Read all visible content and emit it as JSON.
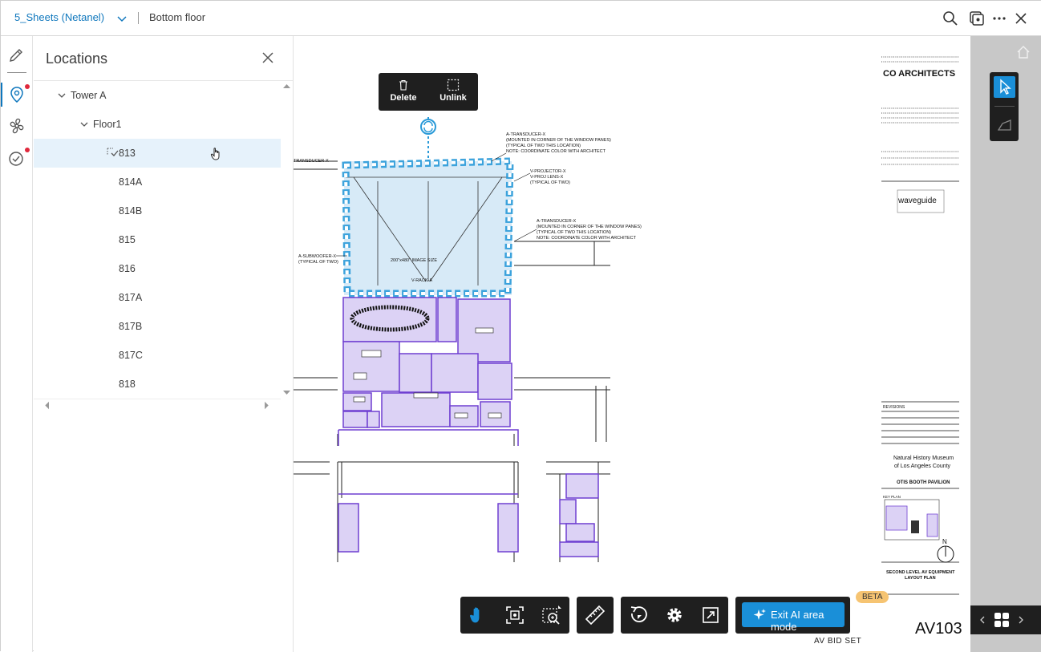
{
  "topbar": {
    "project_name": "5_Sheets",
    "project_owner": "(Netanel)",
    "sheet_name": "Bottom floor",
    "icons": [
      "search-icon",
      "compare-icon",
      "more-icon",
      "close-icon"
    ]
  },
  "rail": {
    "items": [
      "markup-pen-icon",
      "location-pin-icon",
      "fan-icon",
      "checklist-icon"
    ]
  },
  "locations_panel": {
    "title": "Locations",
    "tree": [
      {
        "label": "Tower A",
        "level": 0,
        "expanded": true
      },
      {
        "label": "Floor1",
        "level": 1,
        "expanded": true
      },
      {
        "label": "813",
        "level": 2,
        "selected": true
      },
      {
        "label": "814A",
        "level": 2
      },
      {
        "label": "814B",
        "level": 2
      },
      {
        "label": "815",
        "level": 2
      },
      {
        "label": "816",
        "level": 2
      },
      {
        "label": "817A",
        "level": 2
      },
      {
        "label": "817B",
        "level": 2
      },
      {
        "label": "817C",
        "level": 2
      },
      {
        "label": "818",
        "level": 2
      }
    ]
  },
  "context_toolbar": {
    "delete_label": "Delete",
    "unlink_label": "Unlink"
  },
  "drawing": {
    "callouts": [
      "A-TRANSDUCER-X",
      "(MOUNTED IN CORNER OF THE WINDOW PANES)",
      "(TYPICAL OF TWO THIS LOCATION)",
      "NOTE: COORDINATE COLOR WITH ARCHITECT",
      "V-PROJECTOR-X",
      "V-PROJ LENS-X",
      "(TYPICAL OF TWO)",
      "A-SUBWOOFER-X",
      "V-RACK-A",
      "200\"x480\" IMAGE SIZE",
      "TRANSDUCER-X"
    ],
    "title_block": {
      "firm": "CO ARCHITECTS",
      "consultant": "waveguide",
      "revisions": "REVISIONS",
      "project_line1": "Natural History Museum",
      "project_line2": "of Los Angeles County",
      "project_line3": "OTIS BOOTH PAVILION",
      "key_plan": "KEY PLAN",
      "north": "N",
      "sheet_title_1": "SECOND LEVEL AV EQUIPMENT",
      "sheet_title_2": "LAYOUT PLAN",
      "sheet_number": "AV103",
      "set_label": "AV BID SET"
    }
  },
  "bottom_toolbar": {
    "tools": [
      "pan-hand-icon",
      "fit-view-icon",
      "zoom-area-icon",
      "measure-icon",
      "rotate-icon",
      "settings-icon",
      "fullscreen-icon"
    ],
    "ai_button_label": "Exit AI area mode",
    "beta_badge": "BETA"
  },
  "colors": {
    "accent": "#0f77bd",
    "room_fill": "#dcd2f5",
    "room_stroke": "#6f3fd1",
    "area_fill": "#d7eaf7",
    "area_stroke": "#2a9ad8",
    "toolbar_bg": "#1f1f1f",
    "ai_button": "#1a8fd8",
    "beta_badge": "#f6c472"
  }
}
